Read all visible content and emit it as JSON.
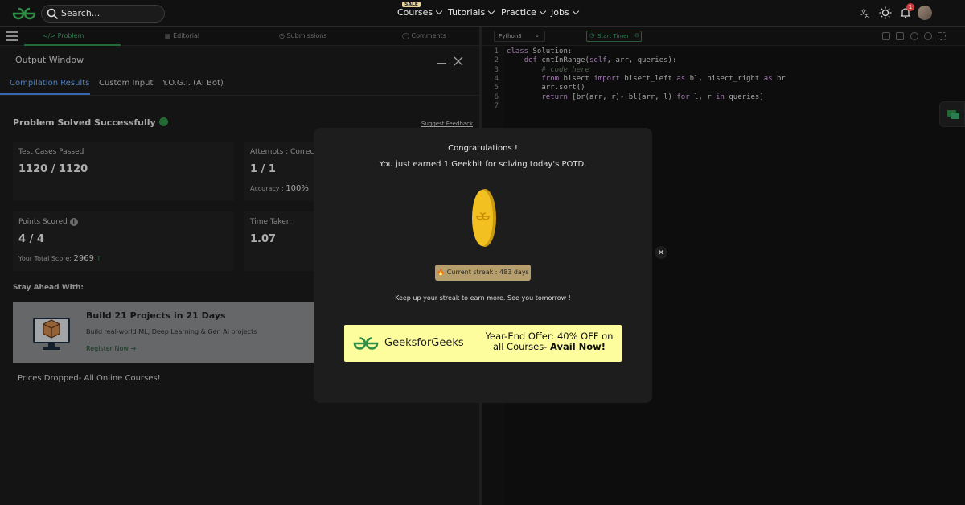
{
  "nav": {
    "search_placeholder": "Search...",
    "sale_badge": "SALE",
    "links": [
      "Courses",
      "Tutorials",
      "Practice",
      "Jobs"
    ],
    "notification_count": "1"
  },
  "problem_tabs": [
    "Problem",
    "Editorial",
    "Submissions",
    "Comments"
  ],
  "output": {
    "title": "Output Window",
    "tabs": [
      "Compilation Results",
      "Custom Input",
      "Y.O.G.I. (AI Bot)"
    ],
    "status": "Problem Solved Successfully",
    "feedback": "Suggest Feedback",
    "cards": {
      "test_label": "Test Cases Passed",
      "test_value": "1120 / 1120",
      "attempts_label": "Attempts : Correct /",
      "attempts_value": "1 / 1",
      "accuracy_label": "Accuracy :",
      "accuracy_value": "100%",
      "points_label": "Points Scored",
      "points_value": "4 / 4",
      "total_label": "Your Total Score:",
      "total_value": "2969",
      "time_label": "Time Taken",
      "time_value": "1.07"
    },
    "stay_ahead": "Stay Ahead With:",
    "promo": {
      "heading": "Build 21 Projects in 21 Days",
      "desc": "Build real-world ML, Deep Learning & Gen AI projects",
      "cta": "Register Now"
    },
    "prices": "Prices Dropped- All Online Courses!"
  },
  "editor": {
    "language": "Python3",
    "timer": "Start Timer",
    "lines": [
      {
        "n": "1",
        "parts": [
          [
            "kw",
            "class "
          ],
          [
            "",
            "Solution:"
          ]
        ]
      },
      {
        "n": "2",
        "parts": [
          [
            "",
            "    "
          ],
          [
            "kw",
            "def "
          ],
          [
            "",
            "cntInRange("
          ],
          [
            "kw",
            "self"
          ],
          [
            "",
            ", arr, queries):"
          ]
        ]
      },
      {
        "n": "3",
        "parts": [
          [
            "",
            "        "
          ],
          [
            "cm",
            "# code here"
          ]
        ]
      },
      {
        "n": "4",
        "parts": [
          [
            "",
            "        "
          ],
          [
            "kw",
            "from "
          ],
          [
            "",
            "bisect "
          ],
          [
            "kw",
            "import "
          ],
          [
            "",
            "bisect_left "
          ],
          [
            "kw",
            "as "
          ],
          [
            "",
            "bl, bisect_right "
          ],
          [
            "kw",
            "as "
          ],
          [
            "",
            "br"
          ]
        ]
      },
      {
        "n": "5",
        "parts": [
          [
            "",
            "        arr.sort()"
          ]
        ]
      },
      {
        "n": "6",
        "parts": [
          [
            "",
            "        "
          ],
          [
            "kw",
            "return "
          ],
          [
            "",
            "[br(arr, r)- bl(arr, l) "
          ],
          [
            "kw",
            "for "
          ],
          [
            "",
            "l, r "
          ],
          [
            "kw",
            "in "
          ],
          [
            "",
            "queries]"
          ]
        ]
      },
      {
        "n": "7",
        "parts": [
          [
            "",
            ""
          ]
        ]
      }
    ]
  },
  "modal": {
    "title": "Congratulations !",
    "subtitle": "You just earned 1 Geekbit for solving today's POTD.",
    "streak": "Current streak : 483 days",
    "keep": "Keep up your streak to earn more. See you tomorrow !",
    "close": "×",
    "banner": {
      "brand": "GeeksforGeeks",
      "offer_line1": "Year-End Offer: 40% OFF on",
      "offer_line2_a": "all Courses-",
      "offer_line2_b": "Avail Now!"
    }
  }
}
